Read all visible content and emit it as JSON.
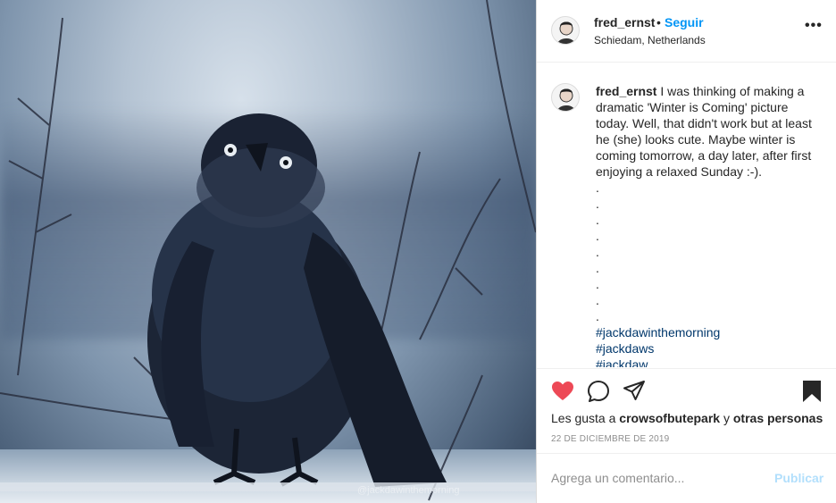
{
  "post": {
    "image_watermark": "@jackdawinthemorning",
    "header": {
      "username": "fred_ernst",
      "separator": "•",
      "follow_label": "Seguir",
      "location": "Schiedam, Netherlands",
      "more_icon": "more-horizontal-icon"
    },
    "caption": {
      "username": "fred_ernst",
      "text": "I was thinking of making a dramatic 'Winter is Coming' picture today. Well, that didn't work but at least he (she) looks cute. Maybe winter is coming tomorrow, a day later, after first enjoying a relaxed Sunday :-).",
      "dots": [
        ".",
        ".",
        ".",
        ".",
        ".",
        ".",
        ".",
        ".",
        "."
      ],
      "hashtags": [
        "#jackdawinthemorning",
        "#jackdaws",
        "#jackdaw"
      ]
    },
    "actions": {
      "like_icon": "heart-filled-icon",
      "like_color": "#ed4956",
      "comment_icon": "comment-icon",
      "share_icon": "paper-plane-icon",
      "save_icon": "bookmark-filled-icon"
    },
    "likes": {
      "prefix": "Les gusta a",
      "user": "crowsofbutepark",
      "connector": "y",
      "others": "otras personas"
    },
    "date": "22 DE DICIEMBRE DE 2019",
    "add_comment": {
      "placeholder": "Agrega un comentario...",
      "publish_label": "Publicar"
    }
  }
}
